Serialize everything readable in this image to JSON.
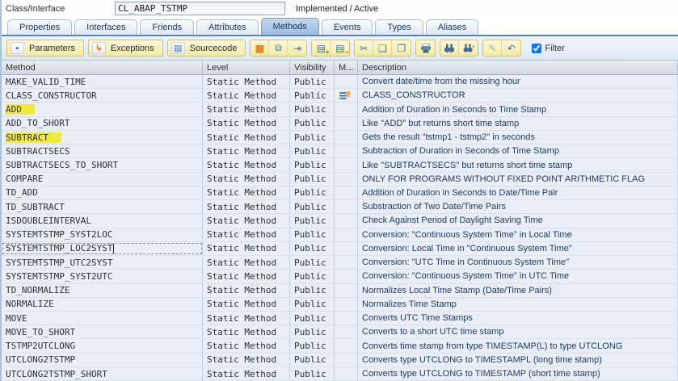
{
  "header": {
    "class_label": "Class/Interface",
    "class_name": "CL_ABAP_TSTMP",
    "status": "Implemented / Active"
  },
  "tabs": {
    "items": [
      "Properties",
      "Interfaces",
      "Friends",
      "Attributes",
      "Methods",
      "Events",
      "Types",
      "Aliases"
    ],
    "active": "Methods"
  },
  "toolbar": {
    "parameters_label": "Parameters",
    "exceptions_label": "Exceptions",
    "sourcecode_label": "Sourcecode",
    "filter_label": "Filter",
    "filter_checked": true,
    "glyphs": {
      "parameters": "▪",
      "exceptions": "↳",
      "sourcecode": "▤",
      "save": "▦",
      "copy_entries": "⧉",
      "insert_entry": "⇥",
      "table_row": "▤",
      "cut": "✂",
      "copy": "❏",
      "paste": "❐",
      "edit": "✎",
      "undo": "↶",
      "plus": "+",
      "minus": "−"
    }
  },
  "colors": {
    "highlight_yellow": "#f2e93e",
    "accent_blue": "#4a7ebb",
    "button_yellow": "#f4e9a4",
    "tab_active": "#9cbedf",
    "row_bg": "#e9eef7"
  },
  "table": {
    "columns": [
      "Method",
      "Level",
      "Visibility",
      "M...",
      "Description"
    ],
    "rows": [
      {
        "method": "MAKE_VALID_TIME",
        "level": "Static Method",
        "visibility": "Public",
        "flag": "",
        "description": "Convert date/time from the missing hour"
      },
      {
        "method": "CLASS_CONSTRUCTOR",
        "level": "Static Method",
        "visibility": "Public",
        "flag": "constructor",
        "description": "CLASS_CONSTRUCTOR"
      },
      {
        "method": "ADD",
        "level": "Static Method",
        "visibility": "Public",
        "flag": "",
        "description": "Addition of Duration in Seconds to Time Stamp",
        "highlight": true
      },
      {
        "method": "ADD_TO_SHORT",
        "level": "Static Method",
        "visibility": "Public",
        "flag": "",
        "description": "Like \"ADD\" but returns short time stamp"
      },
      {
        "method": "SUBTRACT",
        "level": "Static Method",
        "visibility": "Public",
        "flag": "",
        "description": "Gets the result \"tstmp1 - tstmp2\" in seconds",
        "highlight": true
      },
      {
        "method": "SUBTRACTSECS",
        "level": "Static Method",
        "visibility": "Public",
        "flag": "",
        "description": "Subtraction of Duration in Seconds of Time Stamp"
      },
      {
        "method": "SUBTRACTSECS_TO_SHORT",
        "level": "Static Method",
        "visibility": "Public",
        "flag": "",
        "description": "Like \"SUBTRACTSECS\" but returns short time stamp"
      },
      {
        "method": "COMPARE",
        "level": "Static Method",
        "visibility": "Public",
        "flag": "",
        "description": "ONLY FOR PROGRAMS WITHOUT FIXED POINT ARITHMETIC FLAG"
      },
      {
        "method": "TD_ADD",
        "level": "Static Method",
        "visibility": "Public",
        "flag": "",
        "description": "Addition of Duration in Seconds to Date/Time Pair"
      },
      {
        "method": "TD_SUBTRACT",
        "level": "Static Method",
        "visibility": "Public",
        "flag": "",
        "description": "Substraction of Two Date/Time Pairs"
      },
      {
        "method": "ISDOUBLEINTERVAL",
        "level": "Static Method",
        "visibility": "Public",
        "flag": "",
        "description": "Check Against Period of Daylight Saving Time"
      },
      {
        "method": "SYSTEMTSTMP_SYST2LOC",
        "level": "Static Method",
        "visibility": "Public",
        "flag": "",
        "description": "Conversion: \"Continuous System Time\" in Local Time"
      },
      {
        "method": "SYSTEMTSTMP_LOC2SYST",
        "level": "Static Method",
        "visibility": "Public",
        "flag": "",
        "description": "Conversion: Local Time in \"Continuous System Time\"",
        "selected": true
      },
      {
        "method": "SYSTEMTSTMP_UTC2SYST",
        "level": "Static Method",
        "visibility": "Public",
        "flag": "",
        "description": "Conversion: \"UTC Time in Continuous System Time\""
      },
      {
        "method": "SYSTEMTSTMP_SYST2UTC",
        "level": "Static Method",
        "visibility": "Public",
        "flag": "",
        "description": "Conversion: \"Continuous System Time\" in UTC Time"
      },
      {
        "method": "TD_NORMALIZE",
        "level": "Static Method",
        "visibility": "Public",
        "flag": "",
        "description": "Normalizes Local Time Stamp (Date/Time Pairs)"
      },
      {
        "method": "NORMALIZE",
        "level": "Static Method",
        "visibility": "Public",
        "flag": "",
        "description": "Normalizes Time Stamp"
      },
      {
        "method": "MOVE",
        "level": "Static Method",
        "visibility": "Public",
        "flag": "",
        "description": "Converts UTC Time Stamps"
      },
      {
        "method": "MOVE_TO_SHORT",
        "level": "Static Method",
        "visibility": "Public",
        "flag": "",
        "description": "Converts to a short UTC time stamp"
      },
      {
        "method": "TSTMP2UTCLONG",
        "level": "Static Method",
        "visibility": "Public",
        "flag": "",
        "description": "Converts time stamp from type TIMESTAMP(L) to type UTCLONG"
      },
      {
        "method": "UTCLONG2TSTMP",
        "level": "Static Method",
        "visibility": "Public",
        "flag": "",
        "description": "Converts type UTCLONG to TIMESTAMPL (long time stamp)"
      },
      {
        "method": "UTCLONG2TSTMP_SHORT",
        "level": "Static Method",
        "visibility": "Public",
        "flag": "",
        "description": "Converts type UTCLONG to TIMESTAMP (short time stamp)"
      }
    ]
  }
}
